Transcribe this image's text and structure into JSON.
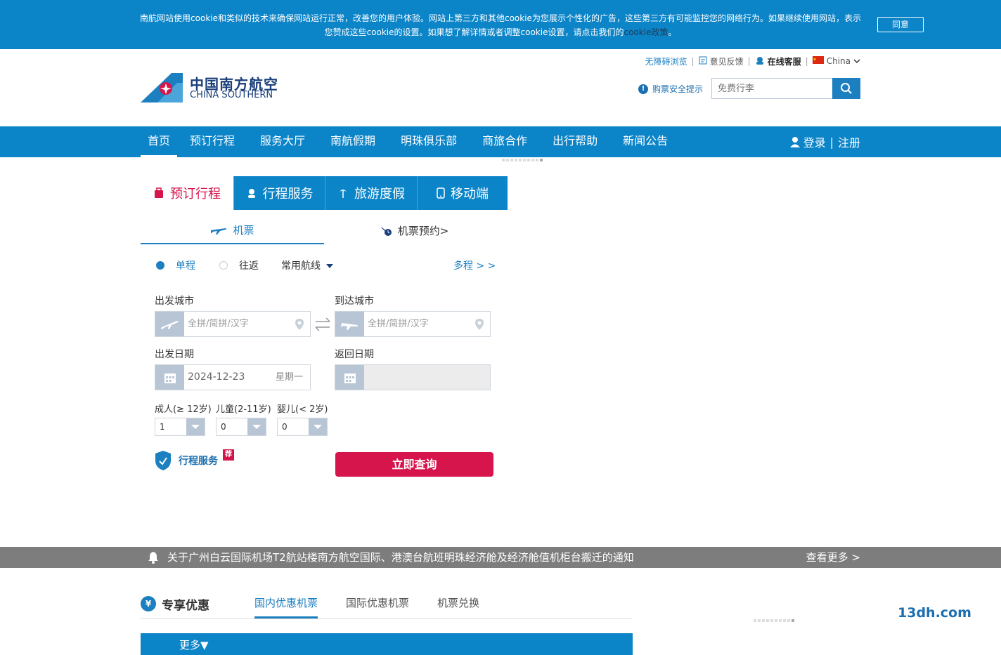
{
  "cookie": {
    "text": "南航网站使用cookie和类似的技术来确保网站运行正常，改善您的用户体验。网站上第三方和其他cookie为您展示个性化的广告，这些第三方有可能监控您的网络行为。如果继续使用网站，表示您赞成这些cookie的设置。如果想了解详情或者调整cookie设置，请点击我们的",
    "link": "cookie政策",
    "end": "。",
    "agree": "同意"
  },
  "header": {
    "logo_cn": "中国南方航空",
    "logo_en": "CHINA SOUTHERN",
    "accessible": "无障碍浏览",
    "feedback": "意见反馈",
    "online_service": "在线客服",
    "region": "China",
    "safety_tip": "购票安全提示",
    "search_placeholder": "免费行李"
  },
  "nav": {
    "items": [
      "首页",
      "预订行程",
      "服务大厅",
      "南航假期",
      "明珠俱乐部",
      "商旅合作",
      "出行帮助",
      "新闻公告"
    ],
    "login": "登录",
    "register": "注册"
  },
  "booking": {
    "tabs": [
      "预订行程",
      "行程服务",
      "旅游度假",
      "移动端"
    ],
    "subtabs": [
      "机票",
      "机票预约>"
    ],
    "trip_types": [
      "单程",
      "往返"
    ],
    "common_routes": "常用航线",
    "multi": "多程 > >",
    "from_label": "出发城市",
    "to_label": "到达城市",
    "city_placeholder": "全拼/简拼/汉字",
    "depart_label": "出发日期",
    "return_label": "返回日期",
    "depart_date": "2024-12-23",
    "depart_weekday": "星期一",
    "adult_label": "成人(≥ 12岁)",
    "child_label": "儿童(2-11岁)",
    "infant_label": "婴儿(< 2岁)",
    "adult_value": "1",
    "child_value": "0",
    "infant_value": "0",
    "trip_service": "行程服务",
    "recommend_tag": "荐",
    "search_button": "立即查询"
  },
  "notice": {
    "text": "关于广州白云国际机场T2航站楼南方航空国际、港澳台航班明珠经济舱及经济舱值机柜台搬迁的通知",
    "more": "查看更多 >"
  },
  "offers": {
    "title": "专享优惠",
    "tabs": [
      "国内优惠机票",
      "国际优惠机票",
      "机票兑换"
    ],
    "more": "更多▼"
  },
  "watermark": "13dh.com",
  "colors": {
    "brand_blue": "#0b84c8",
    "accent_red": "#d6154c",
    "notice_gray": "#7d7d7d"
  }
}
